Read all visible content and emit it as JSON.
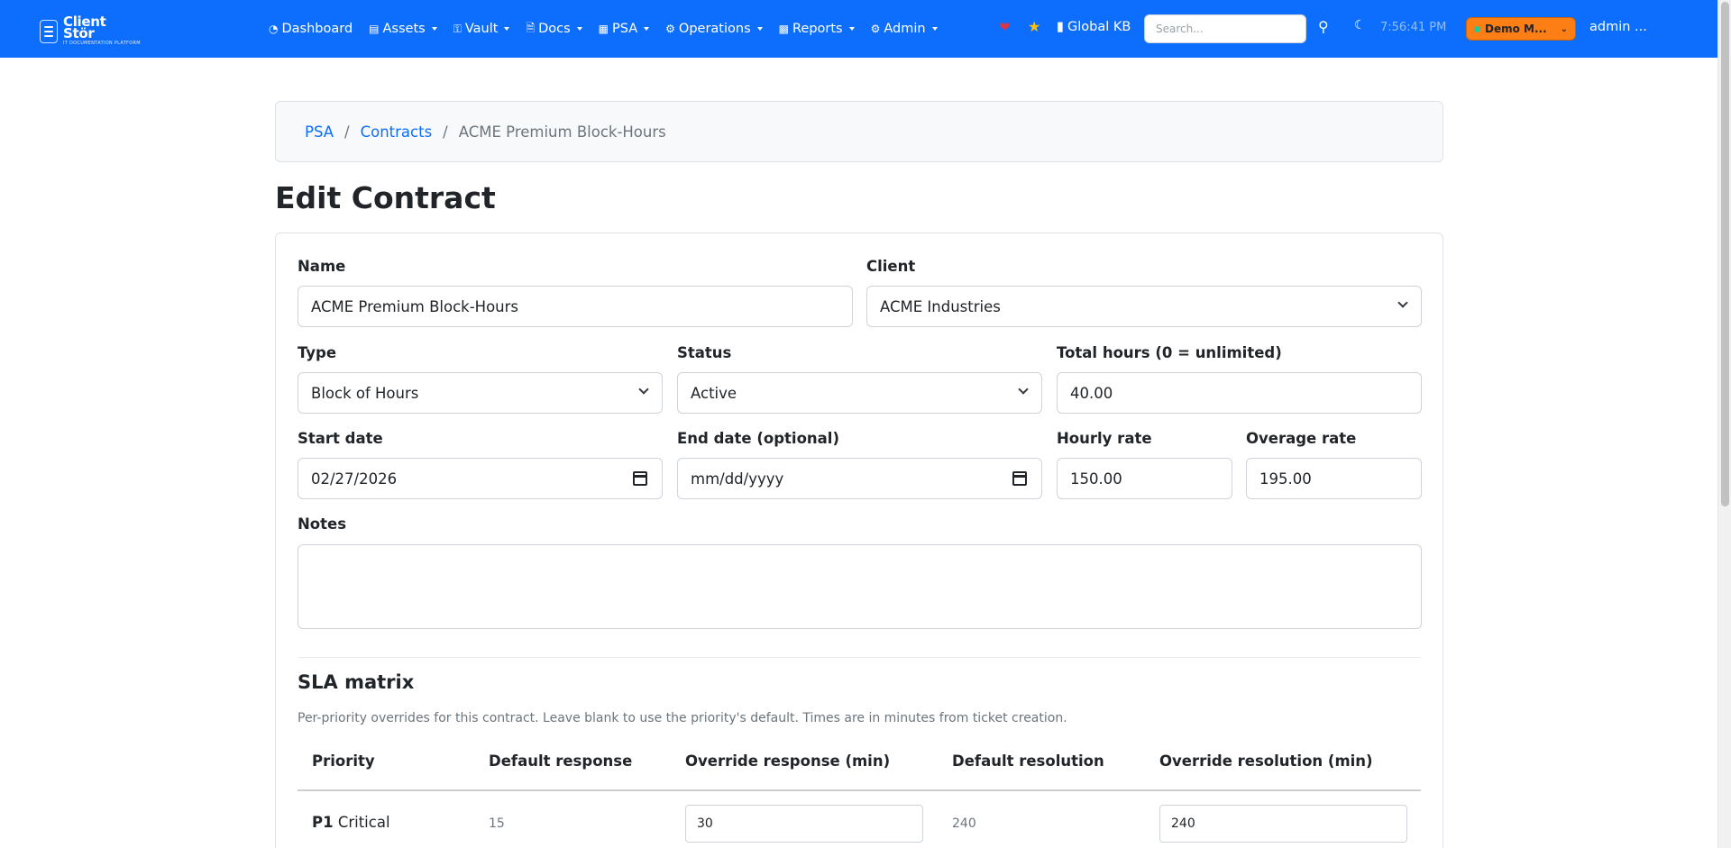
{
  "brand": {
    "name_line1": "Client",
    "name_line2": "Stör",
    "tagline": "IT DOCUMENTATION PLATFORM"
  },
  "nav": {
    "items": [
      {
        "label": "Dashboard",
        "icon": "dashboard-icon",
        "dropdown": false
      },
      {
        "label": "Assets",
        "icon": "assets-icon",
        "dropdown": true
      },
      {
        "label": "Vault",
        "icon": "key-icon",
        "dropdown": true
      },
      {
        "label": "Docs",
        "icon": "file-icon",
        "dropdown": true
      },
      {
        "label": "PSA",
        "icon": "ticket-icon",
        "dropdown": true
      },
      {
        "label": "Operations",
        "icon": "gears-icon",
        "dropdown": true
      },
      {
        "label": "Reports",
        "icon": "chart-icon",
        "dropdown": true
      },
      {
        "label": "Admin",
        "icon": "gear-icon",
        "dropdown": true
      }
    ],
    "global_kb": "Global KB",
    "search_placeholder": "Search...",
    "clock": "7:56:41 PM",
    "demo_label": "Demo M...",
    "admin_label": "admin ...",
    "colors": {
      "bar": "#0d6efd",
      "heart": "#dc3545",
      "star": "#ffc107",
      "demo": "#fd7e14"
    }
  },
  "breadcrumb": {
    "items": [
      "PSA",
      "Contracts"
    ],
    "current": "ACME Premium Block-Hours"
  },
  "page": {
    "title": "Edit Contract"
  },
  "form": {
    "name_label": "Name",
    "name_value": "ACME Premium Block-Hours",
    "client_label": "Client",
    "client_value": "ACME Industries",
    "type_label": "Type",
    "type_value": "Block of Hours",
    "status_label": "Status",
    "status_value": "Active",
    "total_hours_label": "Total hours (0 = unlimited)",
    "total_hours_value": "40.00",
    "start_date_label": "Start date",
    "start_date_value": "02/27/2026",
    "end_date_label": "End date (optional)",
    "end_date_value": "mm/dd/yyyy",
    "hourly_rate_label": "Hourly rate",
    "hourly_rate_value": "150.00",
    "overage_rate_label": "Overage rate",
    "overage_rate_value": "195.00",
    "notes_label": "Notes",
    "notes_value": ""
  },
  "sla": {
    "title": "SLA matrix",
    "description": "Per-priority overrides for this contract. Leave blank to use the priority's default. Times are in minutes from ticket creation.",
    "headers": [
      "Priority",
      "Default response",
      "Override response (min)",
      "Default resolution",
      "Override resolution (min)"
    ],
    "rows": [
      {
        "priority_code": "P1",
        "priority_name": "Critical",
        "default_response": "15",
        "override_response": "30",
        "default_resolution": "240",
        "override_resolution": "240"
      }
    ]
  }
}
